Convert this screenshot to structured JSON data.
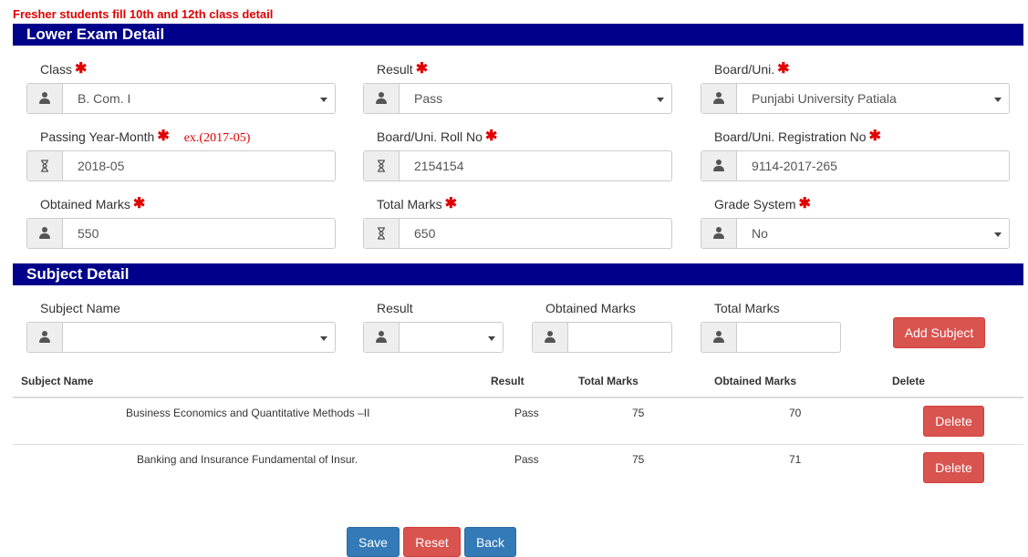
{
  "notice": "Fresher students fill 10th and 12th class detail",
  "lower_exam": {
    "title": "Lower Exam Detail",
    "required_mark": "✱",
    "passing_hint": "ex.(2017-05)",
    "class": {
      "label": "Class",
      "value": "B. Com. I"
    },
    "result": {
      "label": "Result",
      "value": "Pass"
    },
    "board": {
      "label": "Board/Uni.",
      "value": "Punjabi University Patiala"
    },
    "passing_year": {
      "label": "Passing Year-Month",
      "value": "2018-05"
    },
    "roll_no": {
      "label": "Board/Uni. Roll No",
      "value": "2154154"
    },
    "registration_no": {
      "label": "Board/Uni. Registration No",
      "value": "9114-2017-265"
    },
    "obtained_marks": {
      "label": "Obtained Marks",
      "value": "550"
    },
    "total_marks": {
      "label": "Total Marks",
      "value": "650"
    },
    "grade_system": {
      "label": "Grade System",
      "value": "No"
    }
  },
  "subject_detail": {
    "title": "Subject Detail",
    "subject_name_label": "Subject Name",
    "result_label": "Result",
    "obtained_marks_label": "Obtained Marks",
    "total_marks_label": "Total Marks",
    "add_button": "Add Subject",
    "table": {
      "headers": [
        "Subject Name",
        "Result",
        "Total Marks",
        "Obtained Marks",
        "Delete"
      ],
      "rows": [
        {
          "subject": "Business Economics and Quantitative Methods –II",
          "result": "Pass",
          "total": "75",
          "obtained": "70",
          "delete": "Delete"
        },
        {
          "subject": "Banking and Insurance Fundamental of Insur.",
          "result": "Pass",
          "total": "75",
          "obtained": "71",
          "delete": "Delete"
        }
      ]
    }
  },
  "actions": {
    "save": "Save",
    "reset": "Reset",
    "back": "Back"
  },
  "icons": {
    "person": "user-icon",
    "hourglass": "hourglass-icon",
    "required": "asterisk-icon",
    "dropdown": "caret-down-icon"
  },
  "colors": {
    "section_bar": "#00008b",
    "required": "#e00000",
    "danger": "#d9534f",
    "primary": "#337ab7"
  }
}
